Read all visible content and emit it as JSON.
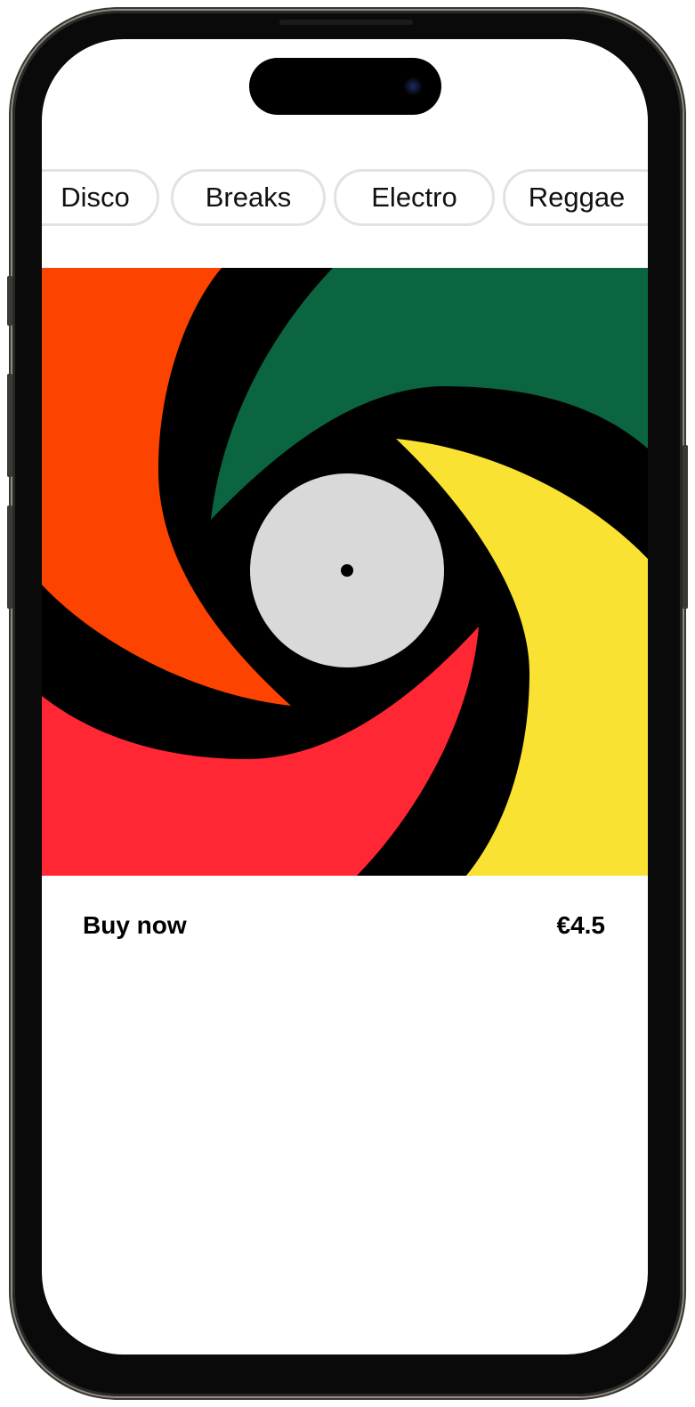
{
  "genres": [
    "Disco",
    "Breaks",
    "Electro",
    "Reggae"
  ],
  "product": {
    "buy_label": "Buy now",
    "price": "€4.5"
  },
  "artwork": {
    "colors": {
      "orange": "#FC4300",
      "green": "#0B6540",
      "yellow": "#FAE232",
      "red": "#FF2734",
      "black": "#000000",
      "label": "#D9D9D9"
    }
  }
}
